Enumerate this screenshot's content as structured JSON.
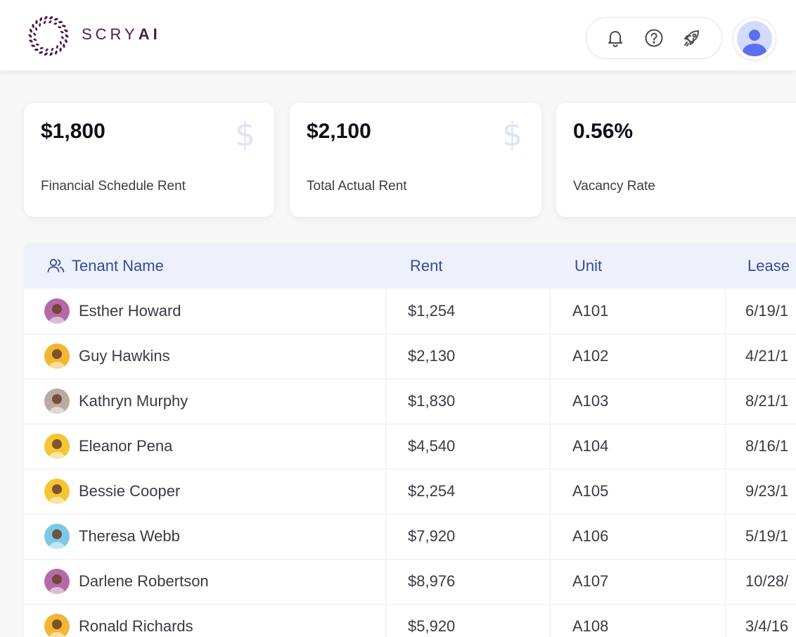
{
  "brand": {
    "name": "SCRY",
    "name_suffix": "AI",
    "color": "#4b1a4e"
  },
  "header": {
    "icons": [
      "bell-icon",
      "help-circle-icon",
      "rocket-icon"
    ],
    "avatar": "user-avatar-icon"
  },
  "stats": [
    {
      "value": "$1,800",
      "label": "Financial Schedule Rent",
      "icon": "dollar-icon"
    },
    {
      "value": "$2,100",
      "label": "Total Actual Rent",
      "icon": "dollar-icon"
    },
    {
      "value": "0.56%",
      "label": "Vacancy Rate"
    }
  ],
  "table": {
    "columns": [
      "Tenant Name",
      "Rent",
      "Unit",
      "Lease"
    ],
    "header_icon": "users-icon",
    "header_color": "#354a98",
    "rows": [
      {
        "name": "Esther Howard",
        "rent": "$1,254",
        "unit": "A101",
        "lease": "6/19/1",
        "avatar_bg": "#b56aa8"
      },
      {
        "name": "Guy Hawkins",
        "rent": "$2,130",
        "unit": "A102",
        "lease": "4/21/1",
        "avatar_bg": "#f2b632"
      },
      {
        "name": "Kathryn Murphy",
        "rent": "$1,830",
        "unit": "A103",
        "lease": "8/21/1",
        "avatar_bg": "#b9aba4"
      },
      {
        "name": "Eleanor Pena",
        "rent": "$4,540",
        "unit": "A104",
        "lease": "8/16/1",
        "avatar_bg": "#f5c535"
      },
      {
        "name": "Bessie Cooper",
        "rent": "$2,254",
        "unit": "A105",
        "lease": "9/23/1",
        "avatar_bg": "#f5c535"
      },
      {
        "name": "Theresa Webb",
        "rent": "$7,920",
        "unit": "A106",
        "lease": "5/19/1",
        "avatar_bg": "#7cc8e6"
      },
      {
        "name": "Darlene Robertson",
        "rent": "$8,976",
        "unit": "A107",
        "lease": "10/28/",
        "avatar_bg": "#b56aa8"
      },
      {
        "name": "Ronald Richards",
        "rent": "$5,920",
        "unit": "A108",
        "lease": "3/4/16",
        "avatar_bg": "#f2b632"
      }
    ]
  }
}
